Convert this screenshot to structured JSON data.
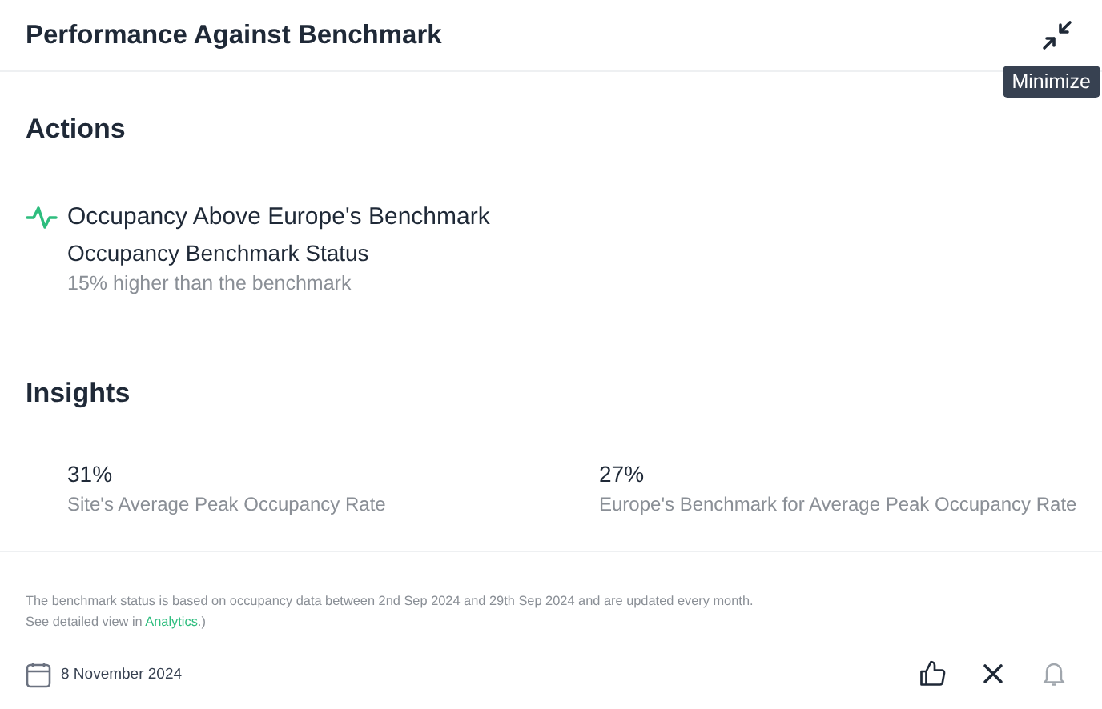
{
  "header": {
    "title": "Performance Against Benchmark",
    "tooltip": "Minimize"
  },
  "actions": {
    "title": "Actions",
    "items": [
      {
        "title": "Occupancy Above Europe's Benchmark",
        "subtitle": "Occupancy Benchmark Status",
        "detail": "15% higher than the benchmark"
      }
    ]
  },
  "insights": {
    "title": "Insights",
    "metrics": [
      {
        "value": "31%",
        "label": "Site's Average Peak Occupancy Rate"
      },
      {
        "value": "27%",
        "label": "Europe's Benchmark for Average Peak Occupancy Rate"
      }
    ]
  },
  "footnote": {
    "text": "The benchmark status is based on occupancy data between 2nd Sep 2024 and 29th Sep 2024 and are updated every month.",
    "prefix": "See detailed view in ",
    "link": "Analytics",
    "suffix": ".)"
  },
  "footer": {
    "date": "8 November 2024",
    "buttons": [
      {
        "kind": "like",
        "disabled": false
      },
      {
        "kind": "close",
        "disabled": false
      },
      {
        "kind": "bell",
        "disabled": true
      }
    ]
  }
}
